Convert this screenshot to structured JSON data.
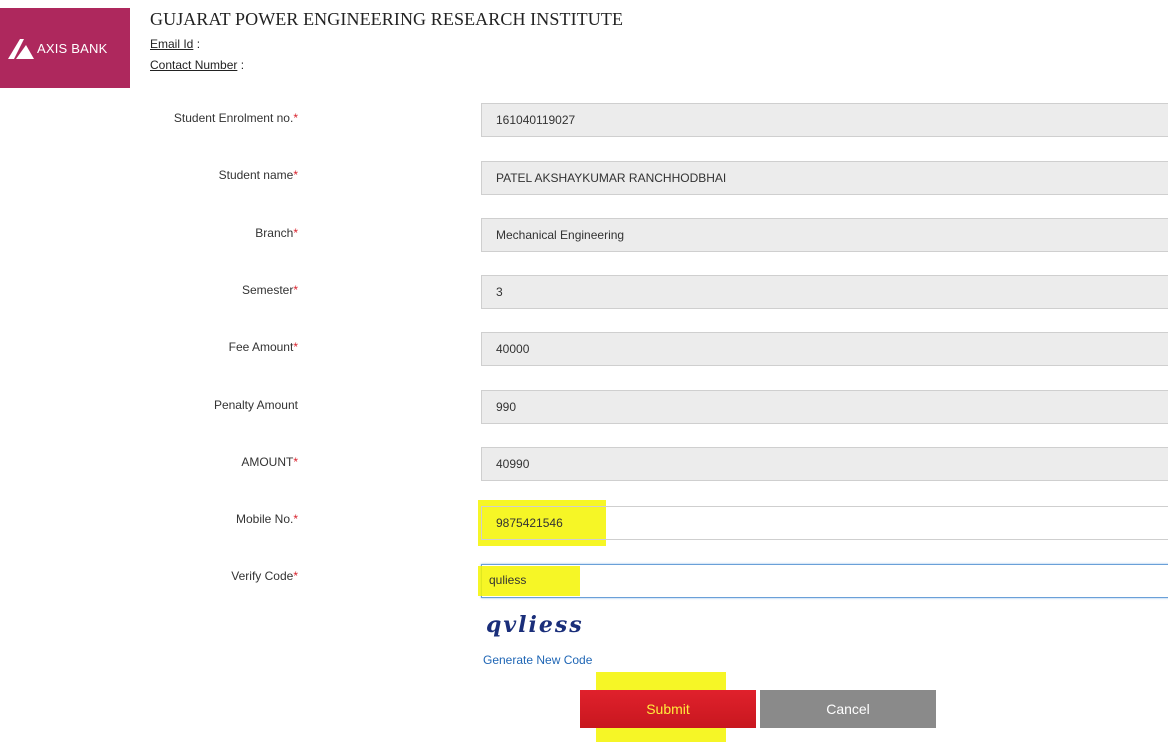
{
  "bank": {
    "logo_text": "AXIS BANK"
  },
  "header": {
    "institute_name": "GUJARAT POWER ENGINEERING RESEARCH INSTITUTE",
    "email_label": "Email Id",
    "email_value": "",
    "contact_label": "Contact Number",
    "contact_value": ""
  },
  "form": {
    "enrolment": {
      "label": "Student Enrolment no.",
      "value": "161040119027"
    },
    "student_name": {
      "label": "Student name",
      "value": "PATEL AKSHAYKUMAR RANCHHODBHAI"
    },
    "branch": {
      "label": "Branch",
      "value": "Mechanical Engineering"
    },
    "semester": {
      "label": "Semester",
      "value": "3"
    },
    "fee_amount": {
      "label": "Fee Amount",
      "value": "40000"
    },
    "penalty_amount": {
      "label": "Penalty Amount",
      "value": "990"
    },
    "amount": {
      "label": "AMOUNT",
      "value": "40990"
    },
    "mobile": {
      "label": "Mobile No.",
      "value": "9875421546"
    },
    "verify_code": {
      "label": "Verify Code",
      "value": "quliess"
    },
    "required_mark": "*",
    "captcha_text": "qvliess",
    "generate_link": "Generate New Code",
    "submit_label": "Submit",
    "cancel_label": "Cancel"
  },
  "colors": {
    "brand": "#ae285d",
    "submit": "#e0212c",
    "cancel": "#8a8a8a",
    "highlight": "#f5f500",
    "link": "#1f66b5"
  }
}
